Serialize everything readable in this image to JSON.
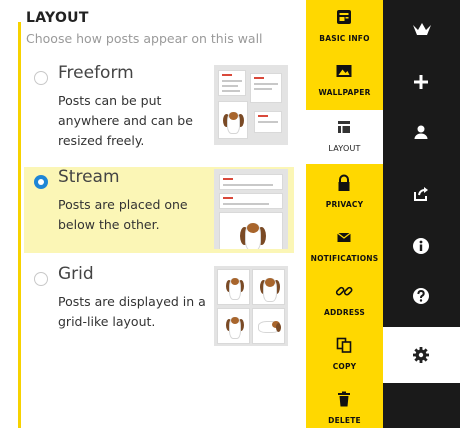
{
  "layout_panel": {
    "title": "LAYOUT",
    "subtitle": "Choose how posts appear on this wall",
    "options": [
      {
        "name": "Freeform",
        "description": "Posts can be put anywhere and can be resized freely.",
        "selected": false
      },
      {
        "name": "Stream",
        "description": "Posts are placed one below the other.",
        "selected": true
      },
      {
        "name": "Grid",
        "description": "Posts are displayed in a grid-like layout.",
        "selected": false
      }
    ]
  },
  "nav": {
    "items": [
      {
        "label": "BASIC INFO",
        "icon": "basic-info-icon"
      },
      {
        "label": "WALLPAPER",
        "icon": "wallpaper-icon"
      },
      {
        "label": "LAYOUT",
        "icon": "layout-icon",
        "active": true
      },
      {
        "label": "PRIVACY",
        "icon": "lock-icon"
      },
      {
        "label": "NOTIFICATIONS",
        "icon": "envelope-icon"
      },
      {
        "label": "ADDRESS",
        "icon": "link-icon"
      },
      {
        "label": "COPY",
        "icon": "copy-icon"
      },
      {
        "label": "DELETE",
        "icon": "trash-icon"
      }
    ]
  },
  "rail": {
    "buttons": [
      "logo-icon",
      "plus-icon",
      "user-icon",
      "share-icon",
      "info-icon",
      "help-icon",
      "gear-icon"
    ],
    "active": "gear-icon"
  },
  "colors": {
    "accent_yellow": "#ffd800",
    "selected_bg": "#fbf6b6",
    "rail_dark": "#1a1a1a",
    "radio_blue": "#1e86d6"
  }
}
